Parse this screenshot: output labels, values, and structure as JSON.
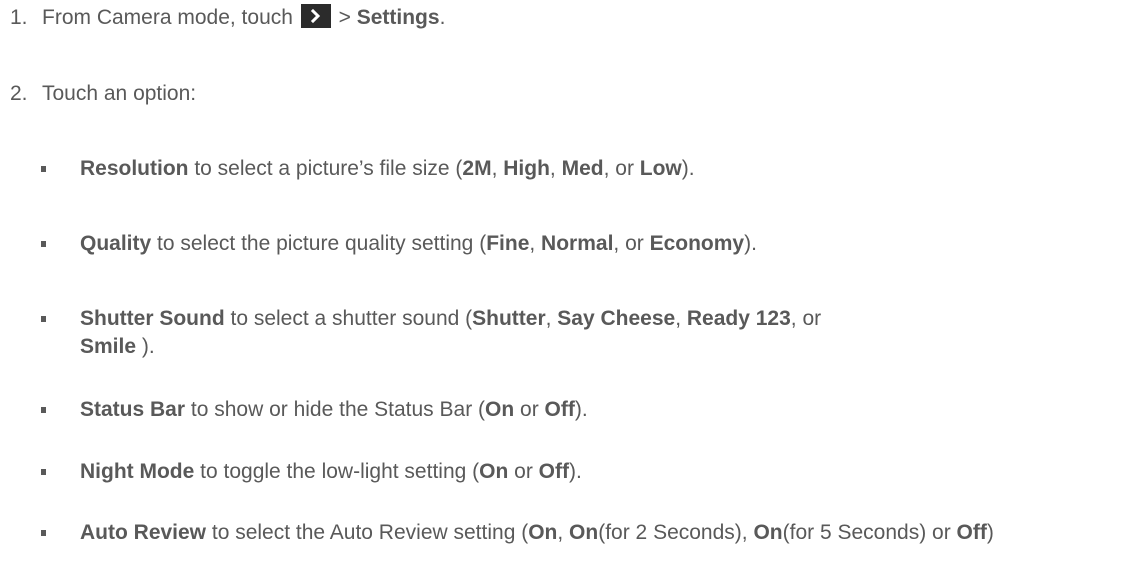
{
  "steps": [
    {
      "number": "1.",
      "text_before": "From Camera mode, touch",
      "icon": "chevron-right-icon",
      "text_after": " > ",
      "bold": "Settings",
      "end": "."
    },
    {
      "number": "2.",
      "text": "Touch an option:"
    }
  ],
  "options": [
    {
      "name": "Resolution",
      "desc": " to select a picture’s file size (",
      "v1": "2M",
      "s1": ", ",
      "v2": "High",
      "s2": ", ",
      "v3": "Med",
      "s3": ", or ",
      "v4": "Low",
      "end": ")."
    },
    {
      "name": "Quality",
      "desc": " to select the picture quality setting (",
      "v1": "Fine",
      "s1": ", ",
      "v2": "Normal",
      "s2": ", or ",
      "v3": "Economy",
      "end": ")."
    },
    {
      "name": "Shutter Sound",
      "desc": " to select a shutter sound (",
      "v1": "Shutter",
      "s1": ", ",
      "v2": "Say Cheese",
      "s2": ", ",
      "v3": "Ready 123",
      "s3": ", or",
      "v4": "Smile",
      "end": " )."
    },
    {
      "name": "Status Bar",
      "desc": " to show or hide the Status Bar (",
      "v1": "On",
      "s1": " or ",
      "v2": "Off",
      "end": ")."
    },
    {
      "name": "Night Mode",
      "desc": " to toggle the low-light setting (",
      "v1": "On",
      "s1": " or ",
      "v2": "Off",
      "end": ")."
    },
    {
      "name": "Auto Review",
      "desc": " to select the Auto Review setting (",
      "v1": "On",
      "s1": ", ",
      "v2": "On",
      "s2": "(for 2 Seconds), ",
      "v3": "On",
      "s3": "(for 5 Seconds) or ",
      "v4": "Off",
      "end": ")"
    }
  ],
  "colors": {
    "text": "#595959",
    "icon_bg": "#2b2b2b",
    "icon_fg": "#ffffff"
  }
}
